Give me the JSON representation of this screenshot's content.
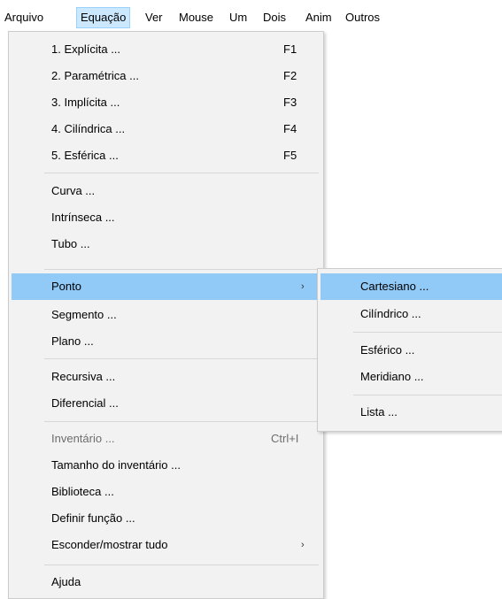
{
  "menubar": {
    "items": [
      "Arquivo",
      "Equação",
      "Ver",
      "Mouse",
      "Um",
      "Dois",
      "Anim",
      "Outros"
    ]
  },
  "equation_menu": {
    "items": [
      {
        "label": "1. Explícita ...",
        "shortcut": "F1"
      },
      {
        "label": "2. Paramétrica ...",
        "shortcut": "F2"
      },
      {
        "label": "3. Implícita ...",
        "shortcut": "F3"
      },
      {
        "label": "4. Cilíndrica ...",
        "shortcut": "F4"
      },
      {
        "label": "5. Esférica ...",
        "shortcut": "F5"
      },
      {
        "label": "Curva ..."
      },
      {
        "label": "Intrínseca ..."
      },
      {
        "label": "Tubo ..."
      },
      {
        "label": "Ponto",
        "submenu_arrow": "›"
      },
      {
        "label": "Segmento ..."
      },
      {
        "label": "Plano ..."
      },
      {
        "label": "Recursiva ..."
      },
      {
        "label": "Diferencial ..."
      },
      {
        "label": "Inventário ...",
        "shortcut": "Ctrl+I"
      },
      {
        "label": "Tamanho do inventário ..."
      },
      {
        "label": "Biblioteca ..."
      },
      {
        "label": "Definir função ..."
      },
      {
        "label": "Esconder/mostrar tudo",
        "submenu_arrow": "›"
      },
      {
        "label": "Ajuda"
      }
    ]
  },
  "point_submenu": {
    "items": [
      "Cartesiano ...",
      "Cilíndrico ...",
      "Esférico ...",
      "Meridiano ...",
      "Lista ..."
    ]
  },
  "colors": {
    "highlight": "#91c9f7",
    "menubar_active": "#cce8ff",
    "menu_background": "#f2f2f2",
    "disabled_text": "#6d6d6d"
  }
}
